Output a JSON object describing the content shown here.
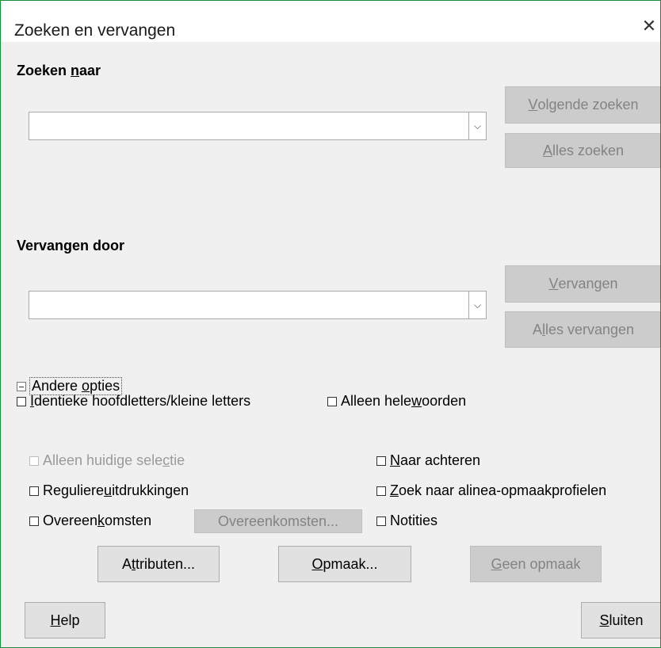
{
  "window": {
    "title": "Zoeken en vervangen",
    "close_glyph": "✕"
  },
  "search": {
    "label_pre": "Zoeken ",
    "label_u": "n",
    "label_post": "aar",
    "value": "",
    "dropdown_glyph": "⌵"
  },
  "replace": {
    "label": "Vervangen door",
    "value": "",
    "dropdown_glyph": "⌵"
  },
  "buttons": {
    "find_next": {
      "u": "V",
      "rest": "olgende zoeken"
    },
    "find_all": {
      "u": "A",
      "rest": "lles zoeken"
    },
    "replace": {
      "u": "V",
      "rest": "ervangen"
    },
    "replace_all": {
      "pre": "A",
      "u": "l",
      "rest": "les vervangen"
    },
    "similarities": "Overeenkomsten...",
    "attributes": {
      "pre": "A",
      "u": "t",
      "rest": "tributen..."
    },
    "format": {
      "u": "O",
      "rest": "pmaak..."
    },
    "no_format": {
      "u": "G",
      "rest": "een opmaak"
    },
    "help": {
      "u": "H",
      "rest": "elp"
    },
    "close": {
      "u": "S",
      "rest": "luiten"
    }
  },
  "options": {
    "match_case": {
      "u": "I",
      "rest": "dentieke hoofdletters/kleine letters"
    },
    "whole_words": {
      "pre": "Alleen hele ",
      "u": "w",
      "rest": "oorden"
    },
    "other_options": {
      "pre": "Andere ",
      "u": "o",
      "rest": "pties"
    },
    "current_selection": {
      "pre": "Alleen huidige sele",
      "u": "c",
      "rest": "tie"
    },
    "backwards": {
      "u": "N",
      "rest": "aar achteren"
    },
    "regex": {
      "pre": "Reguliere ",
      "u": "u",
      "rest": "itdrukkingen"
    },
    "paragraph_styles": {
      "u": "Z",
      "rest": "oek naar alinea-opmaakprofielen"
    },
    "similarity": {
      "pre": "Overeen",
      "u": "k",
      "rest": "omsten"
    },
    "comments": "Notities"
  },
  "colors": {
    "border": "#1e8a3c",
    "content_bg": "#f0f0f0",
    "disabled_text": "#838383"
  }
}
